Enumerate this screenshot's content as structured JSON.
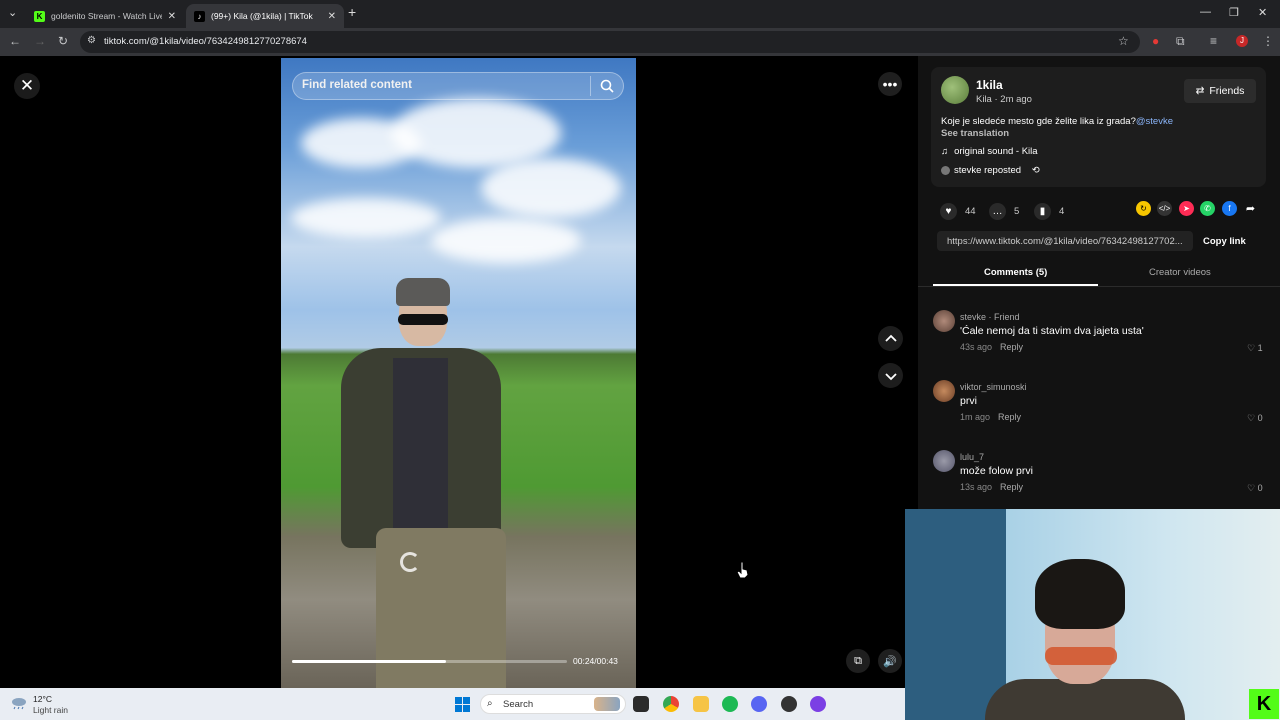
{
  "browser": {
    "tabs": [
      {
        "title": "goldenito Stream - Watch Live",
        "favicon": "kick-icon",
        "active": false
      },
      {
        "title": "(99+) Kila (@1kila) | TikTok",
        "favicon": "tiktok-icon",
        "active": true
      }
    ],
    "new_tab": "+",
    "url": "tiktok.com/@1kila/video/7634249812770278674"
  },
  "video": {
    "search_placeholder": "Find related content",
    "time": "00:24/00:43",
    "progress_fraction": 0.56
  },
  "post": {
    "username": "1kila",
    "nickname_time": "Kila · 2m ago",
    "friends_label": "Friends",
    "description": "Koje je sledeće mesto gde želite lika iz grada?",
    "mention": "@stevke",
    "see_translation": "See translation",
    "sound": "original sound - Kila",
    "reposted": "stevke reposted",
    "likes": "44",
    "comments": "5",
    "saves": "4",
    "link": "https://www.tiktok.com/@1kila/video/76342498127702...",
    "copy_link": "Copy link"
  },
  "tabs": {
    "comments": "Comments (5)",
    "creator_videos": "Creator videos"
  },
  "comments": [
    {
      "user": "stevke · Friend",
      "text": "'Ćale nemoj da ti stavim dva jajeta usta'",
      "time": "43s ago",
      "reply": "Reply",
      "likes": "1"
    },
    {
      "user": "viktor_simunoski",
      "text": "prvi",
      "time": "1m ago",
      "reply": "Reply",
      "likes": "0"
    },
    {
      "user": "lulu_7",
      "text": "može folow prvi",
      "time": "13s ago",
      "reply": "Reply",
      "likes": "0"
    }
  ],
  "taskbar": {
    "temp": "12°C",
    "condition": "Light rain",
    "search": "Search"
  },
  "colors": {
    "accent_link": "#8ab4f8",
    "kick_green": "#53fc18",
    "tiktok_red": "#fe2c55"
  }
}
